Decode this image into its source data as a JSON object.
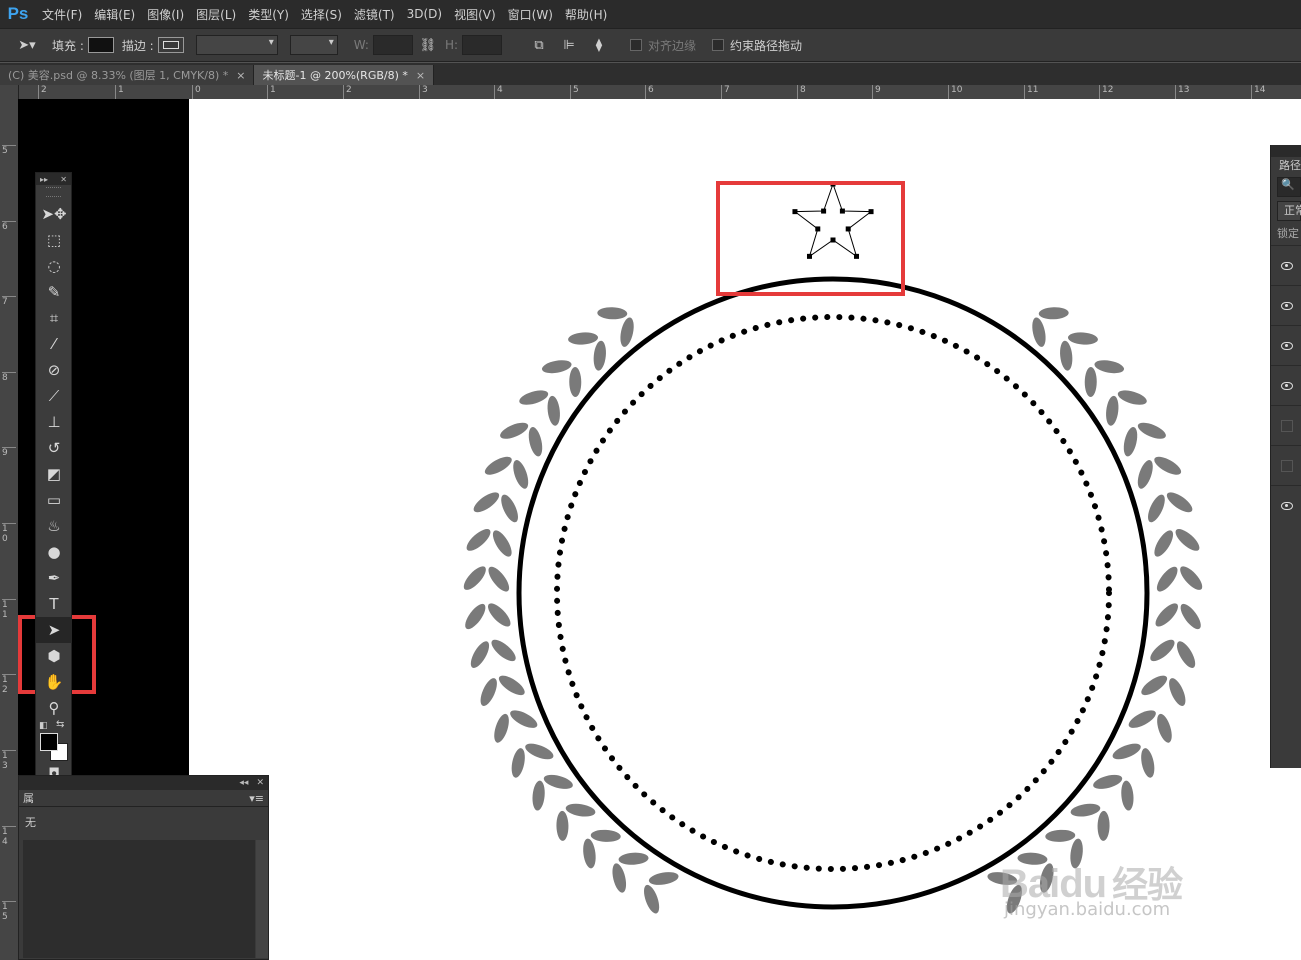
{
  "app": {
    "logo": "Ps"
  },
  "menu": [
    "文件(F)",
    "编辑(E)",
    "图像(I)",
    "图层(L)",
    "类型(Y)",
    "选择(S)",
    "滤镜(T)",
    "3D(D)",
    "视图(V)",
    "窗口(W)",
    "帮助(H)"
  ],
  "options": {
    "fill_label": "填充 :",
    "stroke_label": "描边 :",
    "w_label": "W:",
    "h_label": "H:",
    "align_edges_label": "对齐边缘",
    "constrain_path_label": "约束路径拖动"
  },
  "tabs": [
    {
      "label": "(C) 美容.psd @ 8.33% (图层 1, CMYK/8) *",
      "active": false
    },
    {
      "label": "未标题-1 @ 200%(RGB/8) *",
      "active": true
    }
  ],
  "tab_close": "×",
  "ruler_top": [
    "2",
    "1",
    "0",
    "1",
    "2",
    "3",
    "4",
    "5",
    "6",
    "7",
    "8",
    "9",
    "10",
    "11",
    "12",
    "13",
    "14"
  ],
  "ruler_left": [
    "5",
    "6",
    "7",
    "8",
    "9",
    "1 0",
    "1 1",
    "1 2",
    "1 3",
    "1 4",
    "1 5"
  ],
  "tools": [
    {
      "name": "move-tool",
      "icon": "move-icon"
    },
    {
      "name": "marquee-tool",
      "icon": "marquee-icon"
    },
    {
      "name": "lasso-tool",
      "icon": "lasso-icon"
    },
    {
      "name": "quick-select-tool",
      "icon": "quick-select-icon"
    },
    {
      "name": "crop-tool",
      "icon": "crop-icon"
    },
    {
      "name": "eyedropper-tool",
      "icon": "eyedropper-icon"
    },
    {
      "name": "healing-brush-tool",
      "icon": "bandage-icon"
    },
    {
      "name": "brush-tool",
      "icon": "brush-icon"
    },
    {
      "name": "clone-stamp-tool",
      "icon": "stamp-icon"
    },
    {
      "name": "history-brush-tool",
      "icon": "history-brush-icon"
    },
    {
      "name": "eraser-tool",
      "icon": "eraser-icon"
    },
    {
      "name": "gradient-tool",
      "icon": "gradient-icon"
    },
    {
      "name": "blur-tool",
      "icon": "blur-icon"
    },
    {
      "name": "dodge-tool",
      "icon": "dodge-icon"
    },
    {
      "name": "pen-tool",
      "icon": "pen-icon"
    },
    {
      "name": "type-tool",
      "icon": "type-icon",
      "glyph": "T"
    },
    {
      "name": "path-selection-tool",
      "icon": "arrow-icon",
      "active": true
    },
    {
      "name": "shape-tool",
      "icon": "polygon-icon"
    },
    {
      "name": "hand-tool",
      "icon": "hand-icon"
    },
    {
      "name": "zoom-tool",
      "icon": "zoom-icon"
    }
  ],
  "colors": {
    "foreground": "#000000",
    "background": "#ffffff",
    "highlight": "#e53a3a",
    "ps_blue": "#3ea4f0"
  },
  "float_panel": {
    "tab": "属",
    "row": "无"
  },
  "right_panel": {
    "tab": "路径",
    "search": "🔍",
    "mode": "正常",
    "lock": "锁定"
  },
  "watermark": {
    "brand": "Baidu",
    "brand_cn": "经验",
    "site": "jingyan.baidu.com"
  }
}
